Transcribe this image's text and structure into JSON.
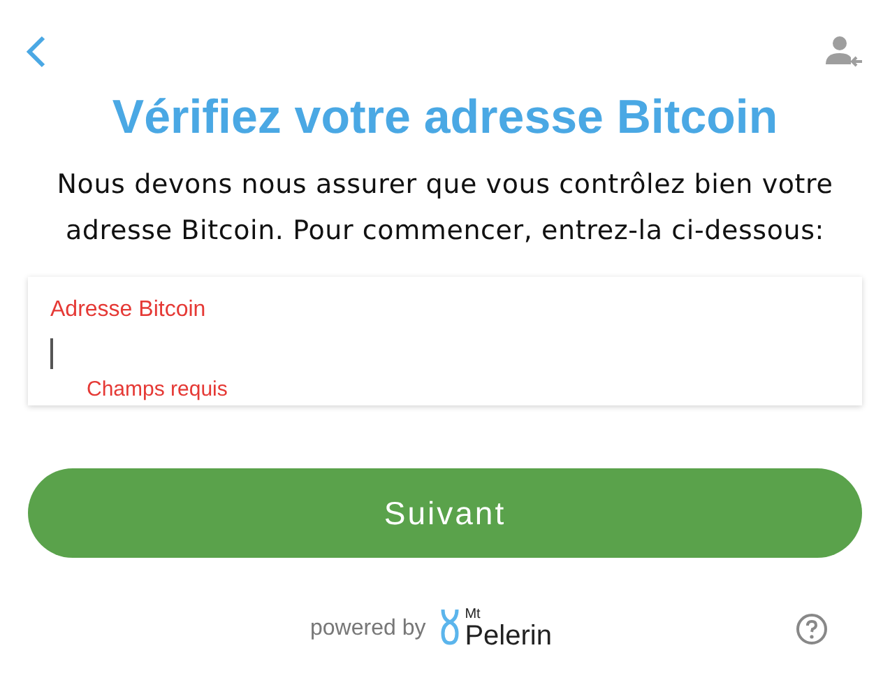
{
  "title": "Vérifiez votre adresse Bitcoin",
  "description": "Nous devons nous assurer que vous contrôlez bien votre adresse Bitcoin. Pour commencer, entrez-la ci-dessous:",
  "address_field": {
    "label": "Adresse Bitcoin",
    "invalid": true,
    "error": "Champs requis"
  },
  "next_button": "Suivant",
  "footer": {
    "powered_by": "powered by",
    "brand_small": "Mt",
    "brand": "Pelerin"
  }
}
